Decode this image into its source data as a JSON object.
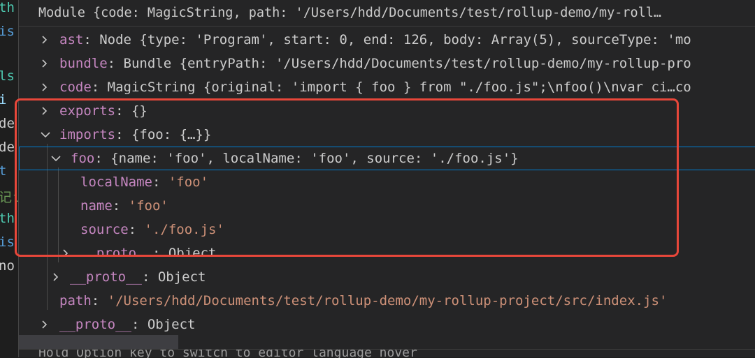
{
  "editor_fragments": [
    {
      "text": "th",
      "color": "#4ec9b0"
    },
    {
      "text": "is",
      "color": "#569cd6"
    },
    {
      "text": "",
      "color": "#cccccc"
    },
    {
      "text": "ls",
      "color": "#4ec9b0"
    },
    {
      "text": " i",
      "color": "#9cdcfe"
    },
    {
      "text": "de",
      "color": "#cccccc"
    },
    {
      "text": "de",
      "color": "#cccccc"
    },
    {
      "text": "t",
      "color": "#569cd6"
    },
    {
      "text": "记ι",
      "color": "#6a9955"
    },
    {
      "text": "th",
      "color": "#4ec9b0"
    },
    {
      "text": "is",
      "color": "#569cd6"
    },
    {
      "text": "no",
      "color": "#cccccc"
    }
  ],
  "header": {
    "text": "Module {code: MagicString, path: '/Users/hdd/Documents/test/rollup-demo/my-roll…"
  },
  "rows": [
    {
      "twisty": "collapsed",
      "key": "ast",
      "sep": ": ",
      "preview": "Node {type: 'Program', start: 0, end: 126, body: Array(5), sourceType: 'mo"
    },
    {
      "twisty": "collapsed",
      "key": "bundle",
      "sep": ": ",
      "preview": "Bundle {entryPath: '/Users/hdd/Documents/test/rollup-demo/my-rollup-pro"
    },
    {
      "twisty": "collapsed",
      "key": "code",
      "sep": ": ",
      "preview": "MagicString {original: 'import { foo } from \"./foo.js\";\\nfoo()\\nvar ci…co"
    },
    {
      "twisty": "collapsed",
      "key": "exports",
      "sep": ": ",
      "preview": "{}"
    },
    {
      "twisty": "expanded",
      "key": "imports",
      "sep": ": ",
      "preview": "{foo: {…}}"
    },
    {
      "twisty": "expanded",
      "key": "foo",
      "sep": ": ",
      "preview": "{name: 'foo', localName: 'foo', source: './foo.js'}"
    },
    {
      "twisty": "none",
      "key": "localName",
      "sep": ": ",
      "value": "'foo'"
    },
    {
      "twisty": "none",
      "key": "name",
      "sep": ": ",
      "value": "'foo'"
    },
    {
      "twisty": "none",
      "key": "source",
      "sep": ": ",
      "value": "'./foo.js'"
    },
    {
      "twisty": "collapsed",
      "key": "__proto__",
      "sep": ": ",
      "preview": "Object"
    },
    {
      "twisty": "collapsed",
      "key": "__proto__",
      "sep": ": ",
      "preview": "Object"
    },
    {
      "twisty": "none",
      "key": "path",
      "sep": ": ",
      "value": "'/Users/hdd/Documents/test/rollup-demo/my-rollup-project/src/index.js'"
    },
    {
      "twisty": "collapsed",
      "key": "__proto__",
      "sep": ": ",
      "preview": "Object"
    }
  ],
  "footer": {
    "hint": "Hold Option key to switch to editor language hover"
  }
}
